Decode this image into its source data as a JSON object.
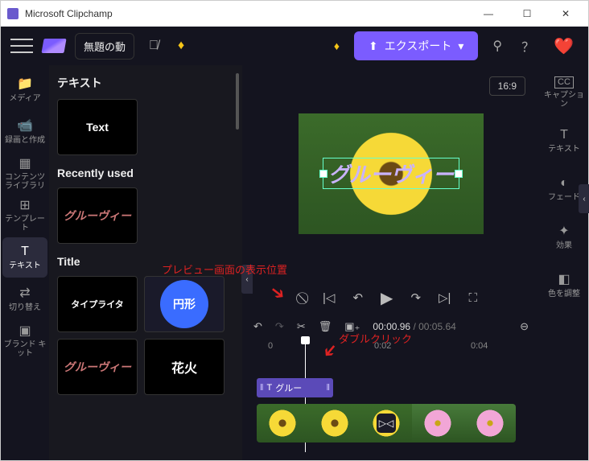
{
  "window": {
    "title": "Microsoft Clipchamp"
  },
  "topbar": {
    "project_title": "無題の動",
    "export_label": "エクスポート"
  },
  "left_rail": {
    "items": [
      {
        "label": "メディア",
        "icon": "📁"
      },
      {
        "label": "録画と作成",
        "icon": "📹"
      },
      {
        "label": "コンテンツライブラリ",
        "icon": "▦"
      },
      {
        "label": "テンプレート",
        "icon": "⊞"
      },
      {
        "label": "テキスト",
        "icon": "T"
      },
      {
        "label": "切り替え",
        "icon": "⇄"
      },
      {
        "label": "ブランド キット",
        "icon": "▣"
      }
    ]
  },
  "panel": {
    "heading1": "テキスト",
    "preset_text": "Text",
    "heading2": "Recently used",
    "preset_groovy": "グルーヴィー",
    "heading3": "Title",
    "preset_typewriter": "タイプライタ",
    "preset_circle": "円形",
    "preset_groovy2": "グルーヴィー",
    "preset_fireworks": "花火"
  },
  "preview": {
    "aspect": "16:9",
    "overlay_text": "グルーヴィー"
  },
  "timeline": {
    "current": "00:00.96",
    "duration": "00:05.64",
    "ruler": {
      "t0": "0",
      "t2": "0:02",
      "t4": "0:04"
    },
    "clip_text_label": "グルー"
  },
  "right_rail": {
    "items": [
      {
        "label": "キャプション",
        "icon": "CC"
      },
      {
        "label": "テキスト",
        "icon": "T"
      },
      {
        "label": "フェード",
        "icon": "◐"
      },
      {
        "label": "効果",
        "icon": "✦"
      },
      {
        "label": "色を調整",
        "icon": "◧"
      }
    ]
  },
  "annotations": {
    "preview_pos": "プレビュー画面の表示位置",
    "dbl_click": "ダブルクリック"
  }
}
